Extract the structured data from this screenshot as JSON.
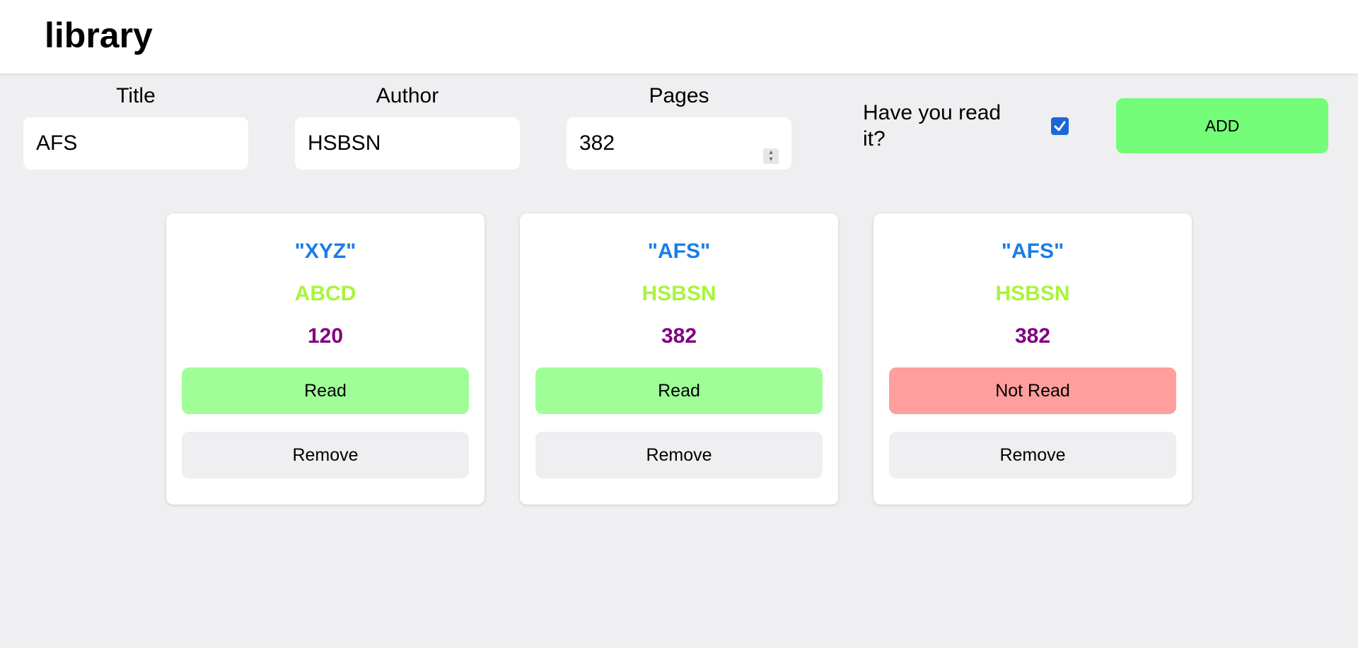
{
  "app": {
    "title": "library"
  },
  "form": {
    "title_label": "Title",
    "title_value": "AFS",
    "author_label": "Author",
    "author_value": "HSBSN",
    "pages_label": "Pages",
    "pages_value": "382",
    "read_label": "Have you read it?",
    "read_checked": true,
    "add_label": "ADD"
  },
  "books": [
    {
      "title": "\"XYZ\"",
      "author": "ABCD",
      "pages": "120",
      "status": "Read",
      "remove": "Remove"
    },
    {
      "title": "\"AFS\"",
      "author": "HSBSN",
      "pages": "382",
      "status": "Read",
      "remove": "Remove"
    },
    {
      "title": "\"AFS\"",
      "author": "HSBSN",
      "pages": "382",
      "status": "Not Read",
      "remove": "Remove"
    }
  ],
  "colors": {
    "title": "#1a7de8",
    "author": "#a8f53a",
    "pages": "#800080",
    "read": "#9ffe98",
    "not_read": "#fe9e9d",
    "add": "#74fd79",
    "background": "#efeef0"
  },
  "icons": {
    "checkbox": "checkmark-icon",
    "spinner": "spin-arrows-icon"
  }
}
